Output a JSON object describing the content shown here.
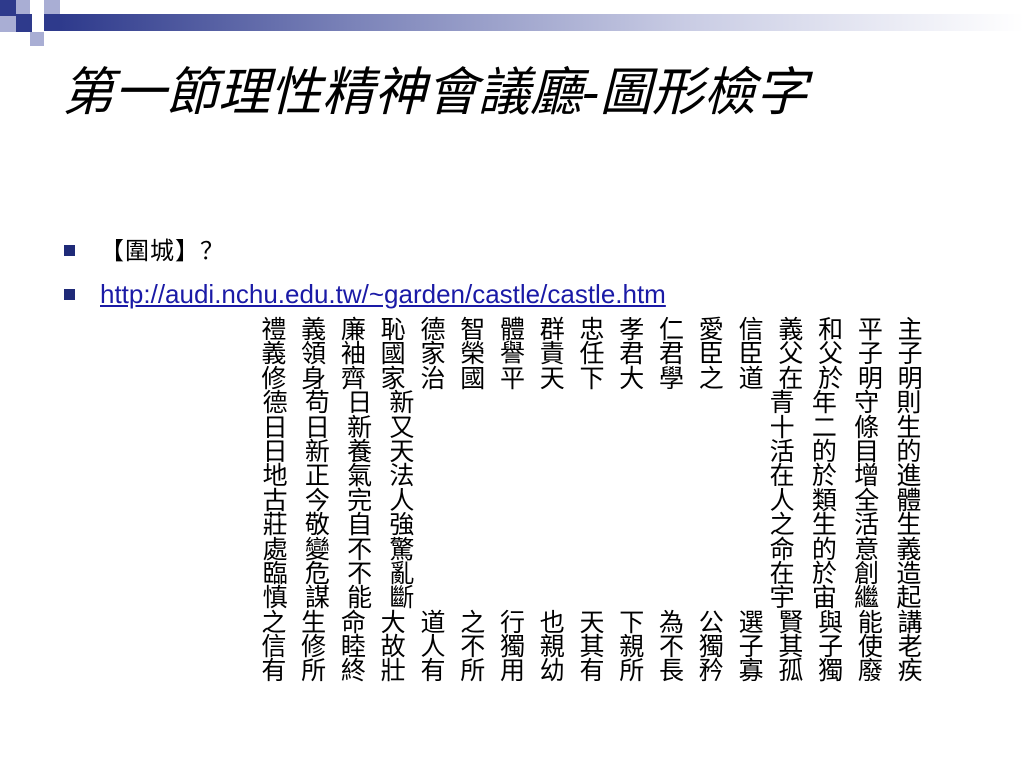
{
  "slide": {
    "title": "第一節理性精神會議廳-圖形檢字",
    "bullets": [
      "【圍城】？",
      "http://audi.nchu.edu.tw/~garden/castle/castle.htm"
    ]
  },
  "poem": {
    "full_rows_top": [
      "禮義廉恥德智體群忠孝仁愛信義和平主",
      "義領袖國家榮譽責任君君臣臣父父子子",
      "修身齊家治國平天下大學之道在於明明"
    ],
    "side_rows": [
      {
        "left": "德苟日新",
        "right": "青年守則"
      },
      {
        "left": "日日新又",
        "right": "十二條生"
      },
      {
        "left": "日新養天",
        "right": "活的目的"
      },
      {
        "left": "地正氣法",
        "right": "在於增進"
      },
      {
        "left": "古今完人",
        "right": "人類全體"
      },
      {
        "left": "莊敬自強",
        "right": "之生活生"
      },
      {
        "left": "處變不驚",
        "right": "命的意義"
      },
      {
        "left": "臨危不亂",
        "right": "在於創造"
      },
      {
        "left": "慎謀能斷",
        "right": "宇宙繼起"
      }
    ],
    "full_rows_bottom": [
      "之生命大道之行也天下為公選賢與能講",
      "信修睦故人不獨親其親不獨子其子使老",
      "有所終壯有所用幼有所長矜寡孤獨廢疾"
    ]
  },
  "colors": {
    "bullet": "#1f2a78",
    "link": "#1a1aa6",
    "deco_dark": "#2e3a8c",
    "deco_light": "#a9aed4"
  }
}
